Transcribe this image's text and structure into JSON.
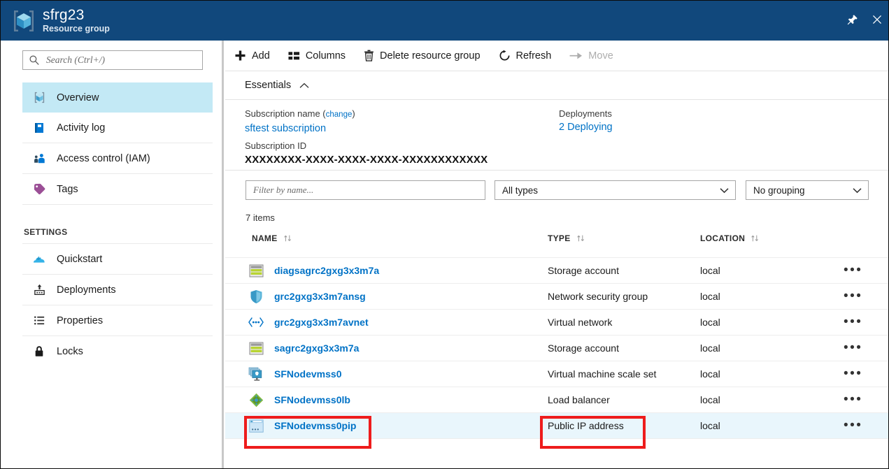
{
  "header": {
    "title": "sfrg23",
    "subtitle": "Resource group",
    "logo_icon": "resource-group-cube-icon",
    "pin_icon": "pin-icon",
    "close_icon": "close-icon",
    "bg_color": "#11487c"
  },
  "sidebar": {
    "search": {
      "placeholder": "Search (Ctrl+/)",
      "value": "",
      "icon": "search-icon"
    },
    "items": [
      {
        "label": "Overview",
        "icon": "cube-outline-icon",
        "selected": true
      },
      {
        "label": "Activity log",
        "icon": "activity-log-book-icon",
        "selected": false
      },
      {
        "label": "Access control (IAM)",
        "icon": "access-control-people-icon",
        "selected": false
      },
      {
        "label": "Tags",
        "icon": "tag-icon",
        "selected": false
      }
    ],
    "section_label": "SETTINGS",
    "settings_items": [
      {
        "label": "Quickstart",
        "icon": "quickstart-cloud-icon",
        "selected": false
      },
      {
        "label": "Deployments",
        "icon": "deployments-upload-icon",
        "selected": false
      },
      {
        "label": "Properties",
        "icon": "properties-list-icon",
        "selected": false
      },
      {
        "label": "Locks",
        "icon": "lock-icon",
        "selected": false
      }
    ],
    "selected_bg": "#c3e9f5"
  },
  "toolbar": {
    "buttons": [
      {
        "label": "Add",
        "icon": "plus-icon",
        "disabled": false
      },
      {
        "label": "Columns",
        "icon": "columns-icon",
        "disabled": false
      },
      {
        "label": "Delete resource group",
        "icon": "trash-icon",
        "disabled": false
      },
      {
        "label": "Refresh",
        "icon": "refresh-icon",
        "disabled": false
      },
      {
        "label": "Move",
        "icon": "arrow-right-icon",
        "disabled": true
      }
    ]
  },
  "essentials": {
    "label": "Essentials",
    "chevron_icon": "chevron-up-icon",
    "subscription_name_key": "Subscription name",
    "change_link": "change",
    "subscription_name_value": "sftest subscription",
    "subscription_id_key": "Subscription ID",
    "subscription_id_value": "XXXXXXXX-XXXX-XXXX-XXXX-XXXXXXXXXXXX",
    "deployments_key": "Deployments",
    "deployments_value": "2 Deploying",
    "link_color": "#0072c6"
  },
  "filters": {
    "name_filter_placeholder": "Filter by name...",
    "name_filter_value": "",
    "type_filter_value": "All types",
    "grouping_filter_value": "No grouping",
    "chevron_icon": "chevron-down-icon"
  },
  "table": {
    "items_count": "7 items",
    "columns": [
      {
        "label": "NAME",
        "sort_icon": "sort-updown-icon"
      },
      {
        "label": "TYPE",
        "sort_icon": "sort-updown-icon"
      },
      {
        "label": "LOCATION",
        "sort_icon": "sort-updown-icon"
      }
    ],
    "menu_glyph": "•••",
    "rows": [
      {
        "name": "diagsagrc2gxg3x3m7a",
        "type": "Storage account",
        "location": "local",
        "icon": "storage-account-icon",
        "highlighted": false
      },
      {
        "name": "grc2gxg3x3m7ansg",
        "type": "Network security group",
        "location": "local",
        "icon": "network-security-group-shield-icon",
        "highlighted": false
      },
      {
        "name": "grc2gxg3x3m7avnet",
        "type": "Virtual network",
        "location": "local",
        "icon": "virtual-network-icon",
        "highlighted": false
      },
      {
        "name": "sagrc2gxg3x3m7a",
        "type": "Storage account",
        "location": "local",
        "icon": "storage-account-icon",
        "highlighted": false
      },
      {
        "name": "SFNodevmss0",
        "type": "Virtual machine scale set",
        "location": "local",
        "icon": "vm-scale-set-icon",
        "highlighted": false
      },
      {
        "name": "SFNodevmss0lb",
        "type": "Load balancer",
        "location": "local",
        "icon": "load-balancer-icon",
        "highlighted": false
      },
      {
        "name": "SFNodevmss0pip",
        "type": "Public IP address",
        "location": "local",
        "icon": "public-ip-address-icon",
        "highlighted": true
      }
    ],
    "row_highlight_color": "#e9f6fc",
    "link_color": "#0072c6"
  },
  "annotations": {
    "color": "#ee1c1c",
    "boxes": [
      {
        "target": "row-name-SFNodevmss0pip"
      },
      {
        "target": "row-type-public-ip-address"
      }
    ]
  }
}
